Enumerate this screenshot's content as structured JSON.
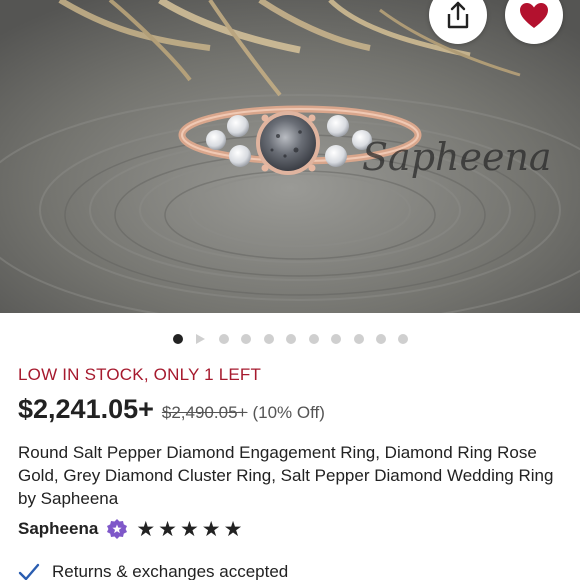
{
  "hero": {
    "watermark": "Sapheena",
    "image_alt": "Salt pepper diamond cluster ring on grey wooden surface"
  },
  "actions": {
    "share_icon": "share-icon",
    "favorite_icon": "heart-icon",
    "favorite_color": "#b3112e"
  },
  "carousel": {
    "total_dots": 11,
    "active_index": 0,
    "video_index": 1
  },
  "stock_status": "LOW IN STOCK, ONLY 1 LEFT",
  "price": {
    "current": "$2,241.05+",
    "original": "$2,490.05+",
    "discount": "(10% Off)"
  },
  "listing_title": "Round Salt Pepper Diamond Engagement Ring, Diamond Ring Rose Gold, Grey Diamond Cluster Ring, Salt Pepper Diamond Wedding Ring by Sapheena",
  "shop": {
    "name": "Sapheena",
    "badge_icon": "star-seller-badge-icon",
    "rating": 5,
    "rating_max": 5
  },
  "policy": {
    "check_icon": "checkmark-icon",
    "returns_text": "Returns & exchanges accepted"
  },
  "colors": {
    "stock_red": "#a61a2e",
    "badge_purple": "#7f58c9",
    "check_blue": "#2a5db0"
  }
}
